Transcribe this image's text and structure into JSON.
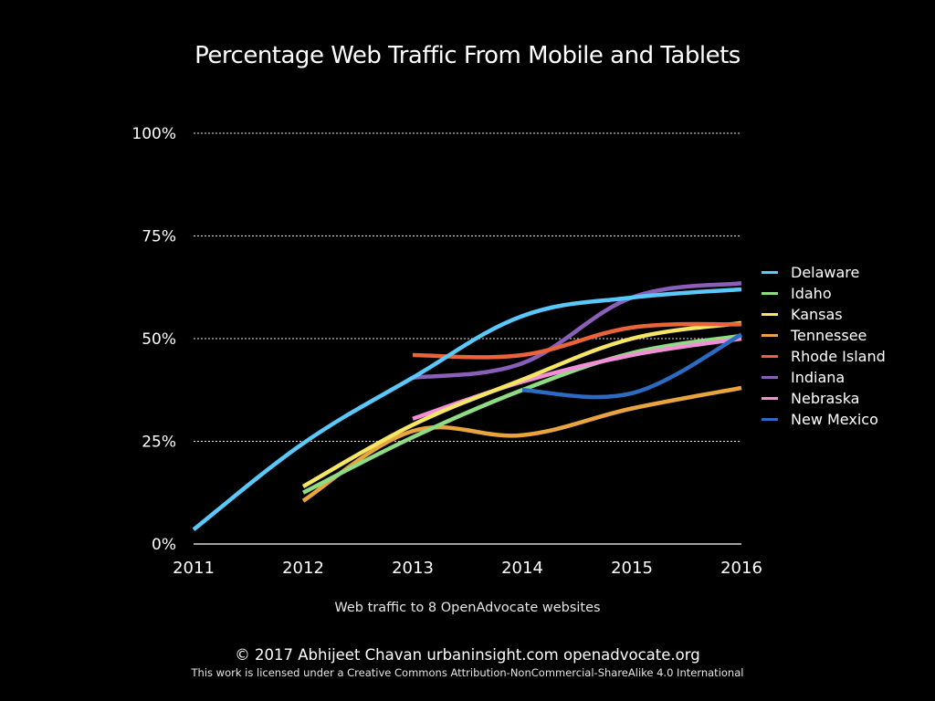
{
  "chart_data": {
    "type": "line",
    "title": "Percentage Web Traffic From Mobile and Tablets",
    "xlabel": "Web traffic to 8 OpenAdvocate websites",
    "ylabel": "",
    "x": [
      2011,
      2012,
      2013,
      2014,
      2015,
      2016
    ],
    "x_tick_labels": [
      "2011",
      "2012",
      "2013",
      "2014",
      "2015",
      "2016"
    ],
    "ylim": [
      0,
      100
    ],
    "y_ticks": [
      0,
      25,
      50,
      75,
      100
    ],
    "y_tick_labels": [
      "0%",
      "25%",
      "50%",
      "75%",
      "100%"
    ],
    "grid": "horizontal dotted",
    "legend_position": "right",
    "smooth": true,
    "series": [
      {
        "name": "Delaware",
        "color": "#5AC8FA",
        "values": [
          3.5,
          24.5,
          40.5,
          55.5,
          60,
          62
        ]
      },
      {
        "name": "Idaho",
        "color": "#8FDC85",
        "values": [
          null,
          12.5,
          26,
          37.5,
          46.5,
          50.7
        ]
      },
      {
        "name": "Kansas",
        "color": "#F5E666",
        "values": [
          null,
          14,
          29,
          40,
          50,
          53.8
        ]
      },
      {
        "name": "Tennessee",
        "color": "#E8A43E",
        "values": [
          null,
          10.5,
          27.5,
          26.5,
          33,
          38
        ]
      },
      {
        "name": "Rhode Island",
        "color": "#E9643A",
        "values": [
          null,
          null,
          46,
          46,
          52.7,
          53.5
        ]
      },
      {
        "name": "Indiana",
        "color": "#8A5FB8",
        "values": [
          null,
          null,
          40.5,
          44,
          60,
          63.5
        ]
      },
      {
        "name": "Nebraska",
        "color": "#F28FD6",
        "values": [
          null,
          null,
          30.5,
          39.5,
          46,
          50
        ]
      },
      {
        "name": "New Mexico",
        "color": "#2C6BC2",
        "values": [
          null,
          null,
          null,
          37.5,
          36.7,
          51
        ]
      }
    ]
  },
  "footer": {
    "credit": "© 2017  Abhijeet Chavan  urbaninsight.com  openadvocate.org",
    "license": "This work is licensed under a Creative Commons Attribution-NonCommercial-ShareAlike 4.0 International"
  }
}
